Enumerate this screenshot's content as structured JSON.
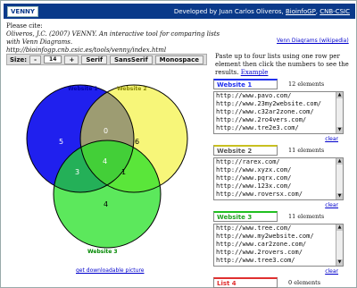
{
  "header": {
    "logo": "VENNY",
    "credit_prefix": "Developed by Juan Carlos Oliveros,",
    "link1": "BioinfoGP",
    "link2": "CNB-CSIC"
  },
  "cite": {
    "line1": "Please cite:",
    "line2": "Oliveros, J.C. (2007) VENNY. An interactive tool for comparing lists with Venn Diagrams.",
    "line3": "http://bioinfogp.cnb.csic.es/tools/venny/index.html"
  },
  "wiki_link": "Venn Diagrams (wikipedia)",
  "toolbar": {
    "size_label": "Size:",
    "minus": "-",
    "size_value": "14",
    "plus": "+",
    "serif": "Serif",
    "sansserif": "SansSerif",
    "monospace": "Monospace"
  },
  "instructions": {
    "text": "Paste up to four lists using one row per element then click the numbers to see the results.",
    "example": "Example"
  },
  "venn": {
    "label_a": "Website 1",
    "label_b": "Website 2",
    "label_c": "Website 3",
    "n_a": "5",
    "n_b": "6",
    "n_c": "4",
    "n_ab": "0",
    "n_ac": "3",
    "n_bc": "1",
    "n_abc": "4",
    "color_a": "#2020ee",
    "color_b": "#f2f020",
    "color_c": "#26e026"
  },
  "download_link": "get downloadable picture",
  "lists": [
    {
      "name": "Website 1",
      "count": "12 elements",
      "color": "#2030ee",
      "rows": [
        "http://www.pavo.com/",
        "http://www.23my2website.com/",
        "http://www.c32ar2zone.com/",
        "http://www.2ro4vers.com/",
        "http://www.tre2e3.com/"
      ],
      "clear": "clear"
    },
    {
      "name": "Website 2",
      "count": "11 elements",
      "color": "#c8c020",
      "rows": [
        "http://rarex.com/",
        "http://www.xyzx.com/",
        "http://www.pqrx.com/",
        "http://www.123x.com/",
        "http://www.roversx.com/"
      ],
      "clear": "clear"
    },
    {
      "name": "Website 3",
      "count": "11 elements",
      "color": "#20c020",
      "rows": [
        "http://www.tree.com/",
        "http://www.my2website.com/",
        "http://www.car2zone.com/",
        "http://www.2rovers.com/",
        "http://www.tree3.com/"
      ],
      "clear": "clear"
    },
    {
      "name": "List 4",
      "count": "0 elements",
      "color": "#e03030",
      "rows": [],
      "clear": ""
    }
  ]
}
